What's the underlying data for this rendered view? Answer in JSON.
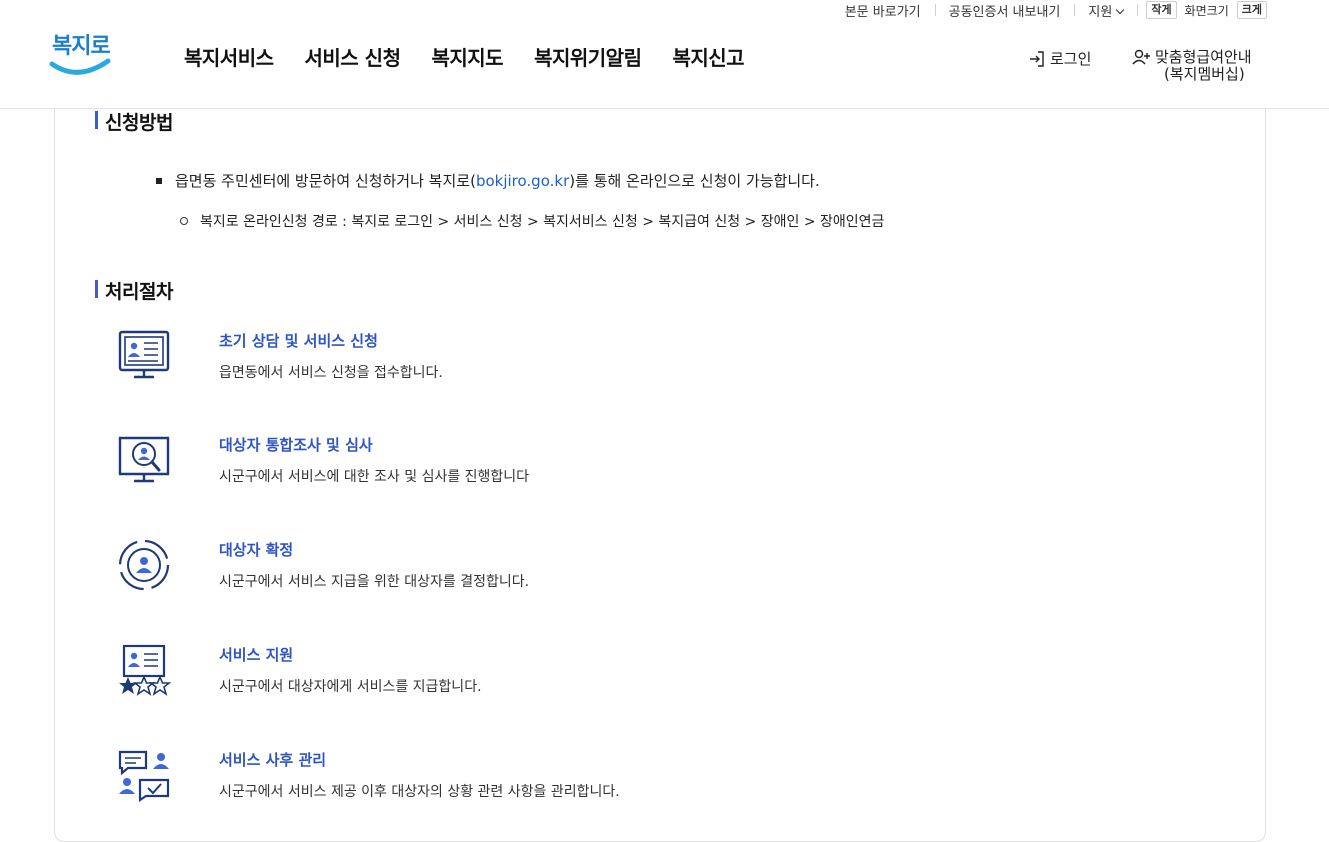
{
  "header": {
    "util_links": [
      "본문 바로가기",
      "공동인증서 내보내기",
      "지원"
    ],
    "font_size": {
      "small": "작게",
      "label": "화면크기",
      "large": "크게"
    },
    "logo_text": "복지로",
    "gnb": [
      "복지서비스",
      "서비스 신청",
      "복지지도",
      "복지위기알림",
      "복지신고"
    ],
    "login": "로그인",
    "member_line1": "맞춤형급여안내",
    "member_line2": "(복지멤버십)"
  },
  "apply": {
    "title": "신청방법",
    "bullet1_pre": "읍면동 주민센터에 방문하여 신청하거나 복지로(",
    "bullet1_link": "bokjiro.go.kr",
    "bullet1_post": ")를 통해 온라인으로 신청이 가능합니다.",
    "bullet2": "복지로 온라인신청 경로 : 복지로 로그인 > 서비스 신청 > 복지서비스 신청 > 복지급여 신청 > 장애인 > 장애인연금"
  },
  "process": {
    "title": "처리절차",
    "steps": [
      {
        "icon": "monitor-profile-icon",
        "title": "초기 상담 및 서비스 신청",
        "desc": "읍면동에서 서비스 신청을 접수합니다."
      },
      {
        "icon": "monitor-search-icon",
        "title": "대상자 통합조사 및 심사",
        "desc": "시군구에서 서비스에 대한 조사 및 심사를 진행합니다"
      },
      {
        "icon": "target-person-icon",
        "title": "대상자 확정",
        "desc": "시군구에서 서비스 지급을 위한 대상자를 결정합니다."
      },
      {
        "icon": "profile-stars-icon",
        "title": "서비스 지원",
        "desc": "시군구에서 대상자에게 서비스를 지급합니다."
      },
      {
        "icon": "chat-people-icon",
        "title": "서비스 사후 관리",
        "desc": "시군구에서 서비스 제공 이후 대상자의 상황 관련 사항을 관리합니다."
      }
    ]
  },
  "colors": {
    "accent": "#2e55c2",
    "icon_navy": "#1f3a78",
    "icon_blue": "#3f67d6",
    "link": "#1a62c6"
  }
}
